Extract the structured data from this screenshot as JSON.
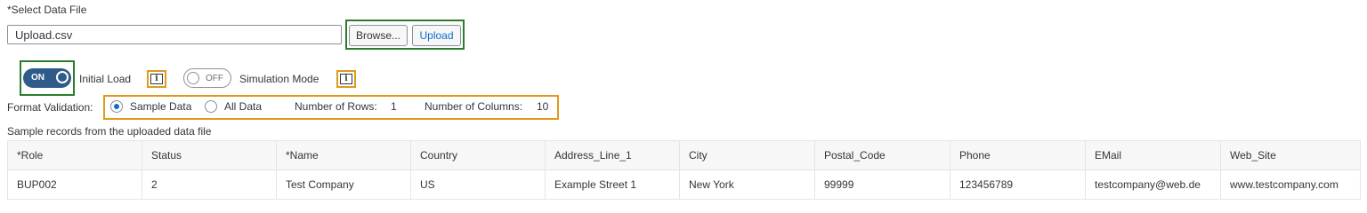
{
  "file": {
    "label": "*Select Data File",
    "value": "Upload.csv",
    "browse_label": "Browse...",
    "upload_label": "Upload"
  },
  "switches": {
    "initial_load": {
      "state": "ON",
      "label": "Initial Load"
    },
    "simulation_mode": {
      "state": "OFF",
      "label": "Simulation Mode"
    },
    "info_icon_glyph": "i"
  },
  "format_validation": {
    "label": "Format Validation:",
    "options": [
      {
        "label": "Sample Data",
        "selected": true
      },
      {
        "label": "All Data",
        "selected": false
      }
    ],
    "rows_label": "Number of Rows:",
    "rows_value": "1",
    "columns_label": "Number of Columns:",
    "columns_value": "10"
  },
  "sample_caption": "Sample records from the uploaded data file",
  "table": {
    "headers": [
      "*Role",
      "Status",
      "*Name",
      "Country",
      "Address_Line_1",
      "City",
      "Postal_Code",
      "Phone",
      "EMail",
      "Web_Site"
    ],
    "rows": [
      [
        "BUP002",
        "2",
        "Test Company",
        "US",
        "Example Street 1",
        "New York",
        "99999",
        "123456789",
        "testcompany@web.de",
        "www.testcompany.com"
      ]
    ]
  },
  "colors": {
    "highlight_green": "#2b7d2b",
    "highlight_orange": "#e09a1c",
    "switch_on": "#2e5b8a",
    "accent": "#0a6ed1"
  }
}
